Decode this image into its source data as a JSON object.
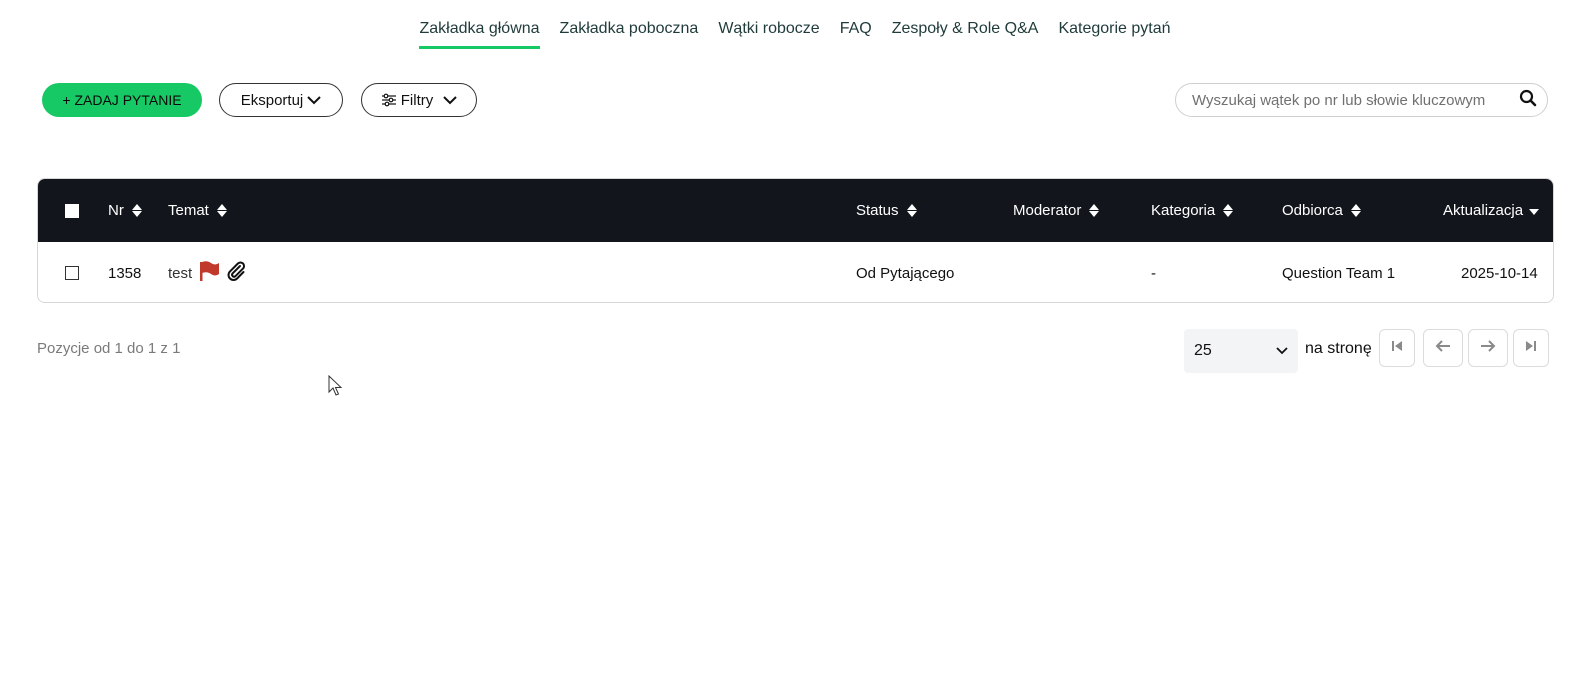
{
  "tabs": [
    {
      "label": "Zakładka główna",
      "active": true
    },
    {
      "label": "Zakładka poboczna",
      "active": false
    },
    {
      "label": "Wątki robocze",
      "active": false
    },
    {
      "label": "FAQ",
      "active": false
    },
    {
      "label": "Zespoły & Role Q&A",
      "active": false
    },
    {
      "label": "Kategorie pytań",
      "active": false
    }
  ],
  "toolbar": {
    "ask_label": "+ ZADAJ PYTANIE",
    "export_label": "Eksportuj",
    "filters_label": "Filtry"
  },
  "search": {
    "placeholder": "Wyszukaj wątek po nr lub słowie kluczowym",
    "value": ""
  },
  "table": {
    "columns": {
      "nr": "Nr",
      "topic": "Temat",
      "status": "Status",
      "moderator": "Moderator",
      "category": "Kategoria",
      "recipient": "Odbiorca",
      "updated": "Aktualizacja"
    },
    "rows": [
      {
        "nr": "1358",
        "topic": "test",
        "flagged": true,
        "has_attachment": true,
        "status": "Od Pytającego",
        "moderator": "",
        "category": "-",
        "recipient": "Question Team 1",
        "updated": "2025-10-14"
      }
    ]
  },
  "pagination": {
    "info": "Pozycje od 1 do 1 z 1",
    "page_size": "25",
    "per_page_label": "na stronę"
  },
  "colors": {
    "accent": "#17c964",
    "header_bg": "#12151c",
    "flag": "#c0392b"
  }
}
